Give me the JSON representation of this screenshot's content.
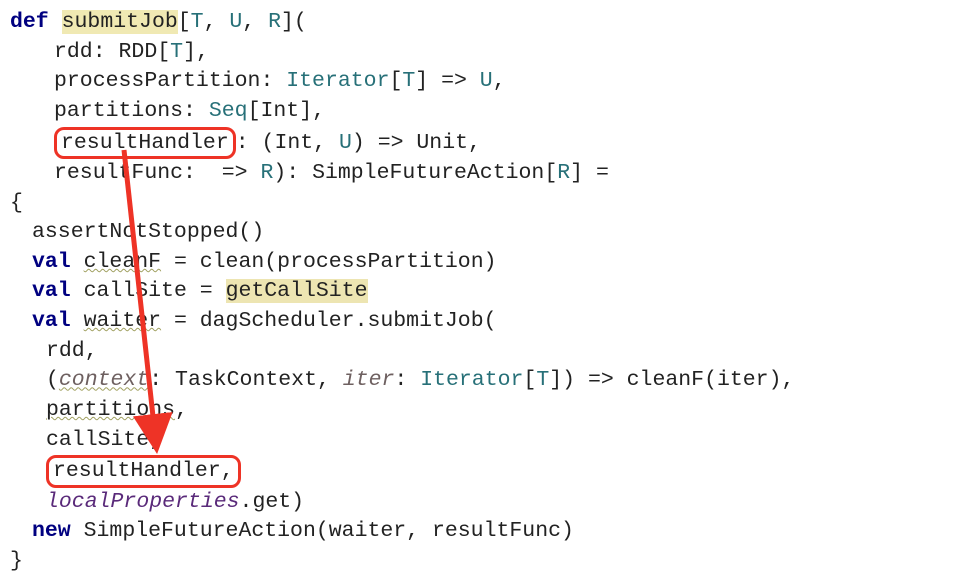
{
  "t": {
    "def": "def",
    "fn": "submitJob",
    "lb": "[",
    "T": "T",
    "U": "U",
    "R": "R",
    "rb": "]",
    "op": "(",
    "cp": ")",
    "eq": " = ",
    "colon": ": ",
    "arrow": " => ",
    "comma": ", ",
    "commaend": ",",
    "lc": "{",
    "rc": "}",
    "new": "new",
    "val": "val",
    "rdd": "rdd",
    "RDD": "RDD",
    "processPartition": "processPartition",
    "Iterator": "Iterator",
    "partitions": "partitions",
    "Seq": "Seq",
    "Int": "Int",
    "resultHandler": "resultHandler",
    "Unit": "Unit",
    "resultFunc": "resultFunc",
    "SimpleFutureAction": "SimpleFutureAction",
    "assertNotStopped": "assertNotStopped()",
    "cleanF": "cleanF",
    "clean": " = clean(processPartition)",
    "callSite": "callSite",
    "getCallSite": "getCallSite",
    "waiter": "waiter",
    "dagSubmit": " = dagScheduler.submitJob(",
    "context": "context",
    "TaskContext": " TaskContext, ",
    "iter": "iter",
    "cleanFiter": "cleanF(iter),",
    "localProperties": "localProperties",
    "get": ".get)",
    "sfaTail": " SimpleFutureAction(waiter, resultFunc)",
    "spc": " "
  },
  "annotations": {
    "box_top": "parameter declaration (resultHandler)",
    "box_bottom": "argument usage (resultHandler,)",
    "arrow_color": "#ee3326"
  }
}
